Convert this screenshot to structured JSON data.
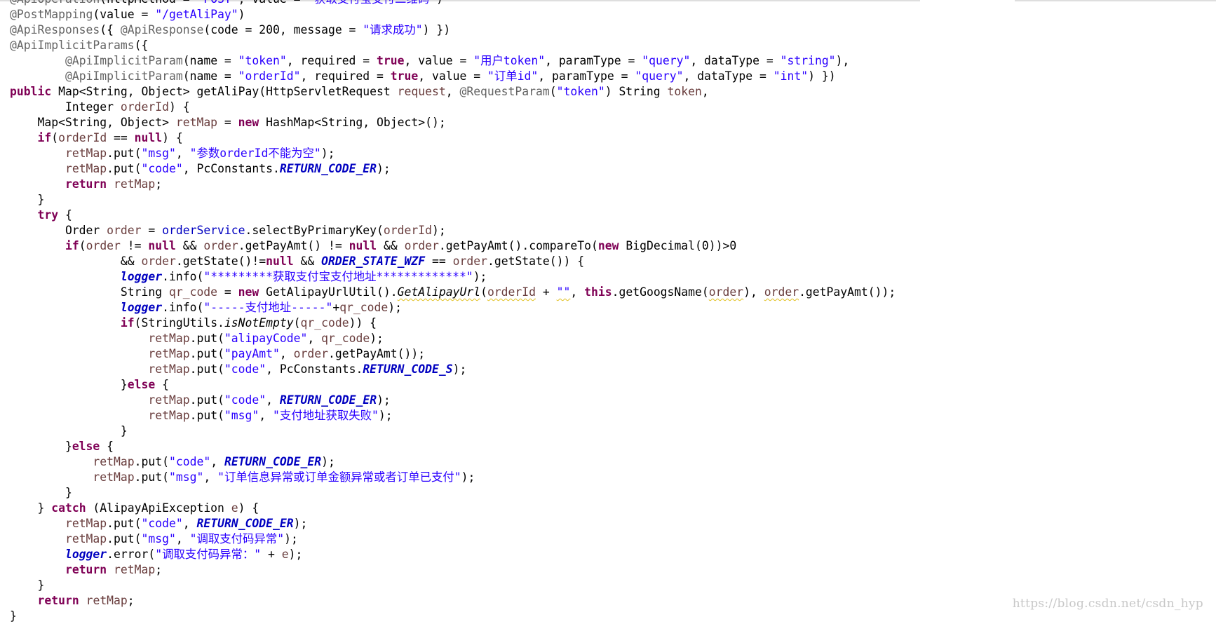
{
  "editor": {
    "code_lines": [
      [
        {
          "t": "@ApiOperation",
          "c": "ann"
        },
        {
          "t": "(httpMethod = "
        },
        {
          "t": "\"POST\"",
          "c": "str"
        },
        {
          "t": ", value = "
        },
        {
          "t": "\"获取支付宝支付二维码\"",
          "c": "str"
        },
        {
          "t": ")"
        }
      ],
      [
        {
          "t": "@PostMapping",
          "c": "ann"
        },
        {
          "t": "(value = "
        },
        {
          "t": "\"/getAliPay\"",
          "c": "str"
        },
        {
          "t": ")"
        }
      ],
      [
        {
          "t": "@ApiResponses",
          "c": "ann"
        },
        {
          "t": "({ "
        },
        {
          "t": "@ApiResponse",
          "c": "ann"
        },
        {
          "t": "(code = 200, message = "
        },
        {
          "t": "\"请求成功\"",
          "c": "str"
        },
        {
          "t": ") })"
        }
      ],
      [
        {
          "t": "@ApiImplicitParams",
          "c": "ann"
        },
        {
          "t": "({"
        }
      ],
      [
        {
          "t": "        "
        },
        {
          "t": "@ApiImplicitParam",
          "c": "ann"
        },
        {
          "t": "(name = "
        },
        {
          "t": "\"token\"",
          "c": "str"
        },
        {
          "t": ", required = "
        },
        {
          "t": "true",
          "c": "kw"
        },
        {
          "t": ", value = "
        },
        {
          "t": "\"用户token\"",
          "c": "str"
        },
        {
          "t": ", paramType = "
        },
        {
          "t": "\"query\"",
          "c": "str"
        },
        {
          "t": ", dataType = "
        },
        {
          "t": "\"string\"",
          "c": "str"
        },
        {
          "t": "),"
        }
      ],
      [
        {
          "t": "        "
        },
        {
          "t": "@ApiImplicitParam",
          "c": "ann"
        },
        {
          "t": "(name = "
        },
        {
          "t": "\"orderId\"",
          "c": "str"
        },
        {
          "t": ", required = "
        },
        {
          "t": "true",
          "c": "kw"
        },
        {
          "t": ", value = "
        },
        {
          "t": "\"订单id\"",
          "c": "str"
        },
        {
          "t": ", paramType = "
        },
        {
          "t": "\"query\"",
          "c": "str"
        },
        {
          "t": ", dataType = "
        },
        {
          "t": "\"int\"",
          "c": "str"
        },
        {
          "t": ") })"
        }
      ],
      [
        {
          "t": "public",
          "c": "kw"
        },
        {
          "t": " Map<String, Object> getAliPay(HttpServletRequest "
        },
        {
          "t": "request",
          "c": "var"
        },
        {
          "t": ", "
        },
        {
          "t": "@RequestParam",
          "c": "ann"
        },
        {
          "t": "("
        },
        {
          "t": "\"token\"",
          "c": "str"
        },
        {
          "t": ") String "
        },
        {
          "t": "token",
          "c": "var"
        },
        {
          "t": ","
        }
      ],
      [
        {
          "t": "        Integer "
        },
        {
          "t": "orderId",
          "c": "var"
        },
        {
          "t": ") {"
        }
      ],
      [
        {
          "t": "    Map<String, Object> "
        },
        {
          "t": "retMap",
          "c": "var"
        },
        {
          "t": " = "
        },
        {
          "t": "new",
          "c": "kw"
        },
        {
          "t": " HashMap<String, Object>();"
        }
      ],
      [
        {
          "t": "    "
        },
        {
          "t": "if",
          "c": "kw"
        },
        {
          "t": "("
        },
        {
          "t": "orderId",
          "c": "var"
        },
        {
          "t": " == "
        },
        {
          "t": "null",
          "c": "kw"
        },
        {
          "t": ") {"
        }
      ],
      [
        {
          "t": "        "
        },
        {
          "t": "retMap",
          "c": "var"
        },
        {
          "t": ".put("
        },
        {
          "t": "\"msg\"",
          "c": "str"
        },
        {
          "t": ", "
        },
        {
          "t": "\"参数orderId不能为空\"",
          "c": "str"
        },
        {
          "t": ");"
        }
      ],
      [
        {
          "t": "        "
        },
        {
          "t": "retMap",
          "c": "var"
        },
        {
          "t": ".put("
        },
        {
          "t": "\"code\"",
          "c": "str"
        },
        {
          "t": ", PcConstants."
        },
        {
          "t": "RETURN_CODE_ER",
          "c": "sfld"
        },
        {
          "t": ");"
        }
      ],
      [
        {
          "t": "        "
        },
        {
          "t": "return",
          "c": "kw"
        },
        {
          "t": " "
        },
        {
          "t": "retMap",
          "c": "var"
        },
        {
          "t": ";"
        }
      ],
      [
        {
          "t": "    }"
        }
      ],
      [
        {
          "t": "    "
        },
        {
          "t": "try",
          "c": "kw"
        },
        {
          "t": " {"
        }
      ],
      [
        {
          "t": "        Order "
        },
        {
          "t": "order",
          "c": "var"
        },
        {
          "t": " = "
        },
        {
          "t": "orderService",
          "c": "fld"
        },
        {
          "t": ".selectByPrimaryKey("
        },
        {
          "t": "orderId",
          "c": "var"
        },
        {
          "t": ");"
        }
      ],
      [
        {
          "t": "        "
        },
        {
          "t": "if",
          "c": "kw"
        },
        {
          "t": "("
        },
        {
          "t": "order",
          "c": "var"
        },
        {
          "t": " != "
        },
        {
          "t": "null",
          "c": "kw"
        },
        {
          "t": " && "
        },
        {
          "t": "order",
          "c": "var"
        },
        {
          "t": ".getPayAmt() != "
        },
        {
          "t": "null",
          "c": "kw"
        },
        {
          "t": " && "
        },
        {
          "t": "order",
          "c": "var"
        },
        {
          "t": ".getPayAmt().compareTo("
        },
        {
          "t": "new",
          "c": "kw"
        },
        {
          "t": " BigDecimal(0))>0"
        }
      ],
      [
        {
          "t": "                && "
        },
        {
          "t": "order",
          "c": "var"
        },
        {
          "t": ".getState()!="
        },
        {
          "t": "null",
          "c": "kw"
        },
        {
          "t": " && "
        },
        {
          "t": "ORDER_STATE_WZF",
          "c": "sfld"
        },
        {
          "t": " == "
        },
        {
          "t": "order",
          "c": "var"
        },
        {
          "t": ".getState()) {"
        }
      ],
      [
        {
          "t": "                "
        },
        {
          "t": "logger",
          "c": "sfld"
        },
        {
          "t": ".info("
        },
        {
          "t": "\"*********获取支付宝支付地址*************\"",
          "c": "str"
        },
        {
          "t": ");"
        }
      ],
      [
        {
          "t": "                String "
        },
        {
          "t": "qr_code",
          "c": "var"
        },
        {
          "t": " = "
        },
        {
          "t": "new",
          "c": "kw"
        },
        {
          "t": " GetAlipayUrlUtil()."
        },
        {
          "t": "GetAlipayUrl",
          "c": "smtd",
          "w": true
        },
        {
          "t": "("
        },
        {
          "t": "orderId",
          "c": "var",
          "w": true
        },
        {
          "t": " + "
        },
        {
          "t": "\"\"",
          "c": "str",
          "w": true
        },
        {
          "t": ", "
        },
        {
          "t": "this",
          "c": "kw"
        },
        {
          "t": ".getGoogsName("
        },
        {
          "t": "order",
          "c": "var",
          "w": true
        },
        {
          "t": "), "
        },
        {
          "t": "order",
          "c": "var",
          "w": true
        },
        {
          "t": ".getPayAmt());"
        }
      ],
      [
        {
          "t": "                "
        },
        {
          "t": "logger",
          "c": "sfld"
        },
        {
          "t": ".info("
        },
        {
          "t": "\"-----支付地址-----\"",
          "c": "str"
        },
        {
          "t": "+"
        },
        {
          "t": "qr_code",
          "c": "var"
        },
        {
          "t": ");"
        }
      ],
      [
        {
          "t": "                "
        },
        {
          "t": "if",
          "c": "kw"
        },
        {
          "t": "(StringUtils."
        },
        {
          "t": "isNotEmpty",
          "c": "smtd"
        },
        {
          "t": "("
        },
        {
          "t": "qr_code",
          "c": "var"
        },
        {
          "t": ")) {"
        }
      ],
      [
        {
          "t": "                    "
        },
        {
          "t": "retMap",
          "c": "var"
        },
        {
          "t": ".put("
        },
        {
          "t": "\"alipayCode\"",
          "c": "str"
        },
        {
          "t": ", "
        },
        {
          "t": "qr_code",
          "c": "var"
        },
        {
          "t": ");"
        }
      ],
      [
        {
          "t": "                    "
        },
        {
          "t": "retMap",
          "c": "var"
        },
        {
          "t": ".put("
        },
        {
          "t": "\"payAmt\"",
          "c": "str"
        },
        {
          "t": ", "
        },
        {
          "t": "order",
          "c": "var"
        },
        {
          "t": ".getPayAmt());"
        }
      ],
      [
        {
          "t": "                    "
        },
        {
          "t": "retMap",
          "c": "var"
        },
        {
          "t": ".put("
        },
        {
          "t": "\"code\"",
          "c": "str"
        },
        {
          "t": ", PcConstants."
        },
        {
          "t": "RETURN_CODE_S",
          "c": "sfld"
        },
        {
          "t": ");"
        }
      ],
      [
        {
          "t": "                }"
        },
        {
          "t": "else",
          "c": "kw"
        },
        {
          "t": " {"
        }
      ],
      [
        {
          "t": "                    "
        },
        {
          "t": "retMap",
          "c": "var"
        },
        {
          "t": ".put("
        },
        {
          "t": "\"code\"",
          "c": "str"
        },
        {
          "t": ", "
        },
        {
          "t": "RETURN_CODE_ER",
          "c": "sfld"
        },
        {
          "t": ");"
        }
      ],
      [
        {
          "t": "                    "
        },
        {
          "t": "retMap",
          "c": "var"
        },
        {
          "t": ".put("
        },
        {
          "t": "\"msg\"",
          "c": "str"
        },
        {
          "t": ", "
        },
        {
          "t": "\"支付地址获取失败\"",
          "c": "str"
        },
        {
          "t": ");"
        }
      ],
      [
        {
          "t": "                }"
        }
      ],
      [
        {
          "t": "        }"
        },
        {
          "t": "else",
          "c": "kw"
        },
        {
          "t": " {"
        }
      ],
      [
        {
          "t": "            "
        },
        {
          "t": "retMap",
          "c": "var"
        },
        {
          "t": ".put("
        },
        {
          "t": "\"code\"",
          "c": "str"
        },
        {
          "t": ", "
        },
        {
          "t": "RETURN_CODE_ER",
          "c": "sfld"
        },
        {
          "t": ");"
        }
      ],
      [
        {
          "t": "            "
        },
        {
          "t": "retMap",
          "c": "var"
        },
        {
          "t": ".put("
        },
        {
          "t": "\"msg\"",
          "c": "str"
        },
        {
          "t": ", "
        },
        {
          "t": "\"订单信息异常或订单金额异常或者订单已支付\"",
          "c": "str"
        },
        {
          "t": ");"
        }
      ],
      [
        {
          "t": "        }"
        }
      ],
      [
        {
          "t": "    } "
        },
        {
          "t": "catch",
          "c": "kw"
        },
        {
          "t": " (AlipayApiException "
        },
        {
          "t": "e",
          "c": "var"
        },
        {
          "t": ") {"
        }
      ],
      [
        {
          "t": "        "
        },
        {
          "t": "retMap",
          "c": "var"
        },
        {
          "t": ".put("
        },
        {
          "t": "\"code\"",
          "c": "str"
        },
        {
          "t": ", "
        },
        {
          "t": "RETURN_CODE_ER",
          "c": "sfld"
        },
        {
          "t": ");"
        }
      ],
      [
        {
          "t": "        "
        },
        {
          "t": "retMap",
          "c": "var"
        },
        {
          "t": ".put("
        },
        {
          "t": "\"msg\"",
          "c": "str"
        },
        {
          "t": ", "
        },
        {
          "t": "\"调取支付码异常\"",
          "c": "str"
        },
        {
          "t": ");"
        }
      ],
      [
        {
          "t": "        "
        },
        {
          "t": "logger",
          "c": "sfld"
        },
        {
          "t": ".error("
        },
        {
          "t": "\"调取支付码异常：\"",
          "c": "str"
        },
        {
          "t": " + "
        },
        {
          "t": "e",
          "c": "var"
        },
        {
          "t": ");"
        }
      ],
      [
        {
          "t": "        "
        },
        {
          "t": "return",
          "c": "kw"
        },
        {
          "t": " "
        },
        {
          "t": "retMap",
          "c": "var"
        },
        {
          "t": ";"
        }
      ],
      [
        {
          "t": "    }"
        }
      ],
      [
        {
          "t": "    "
        },
        {
          "t": "return",
          "c": "kw"
        },
        {
          "t": " "
        },
        {
          "t": "retMap",
          "c": "var"
        },
        {
          "t": ";"
        }
      ],
      [
        {
          "t": "}"
        }
      ]
    ]
  },
  "watermark": {
    "text": "https://blog.csdn.net/csdn_hyp"
  },
  "colors": {
    "annotation": "#646464",
    "keyword": "#7f0055",
    "string": "#2a00ff",
    "field": "#0000c0",
    "local_variable": "#6a3e3e",
    "warning_underline": "#e0c020",
    "background": "#ffffff"
  }
}
